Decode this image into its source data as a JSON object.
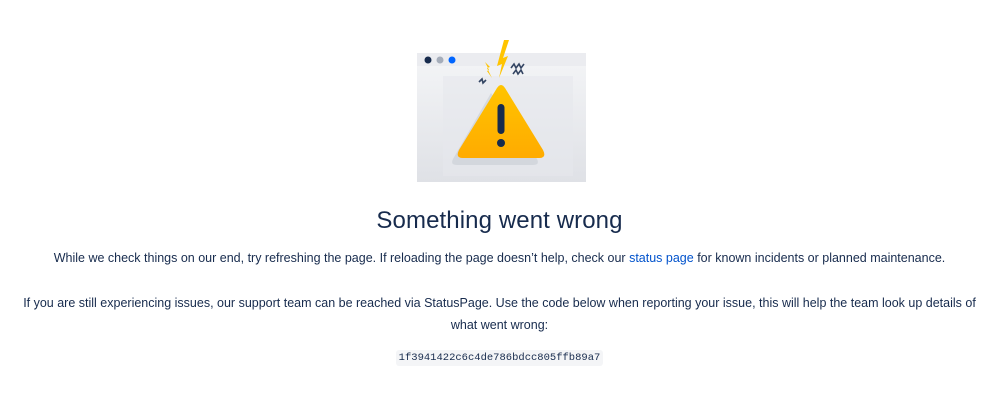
{
  "error": {
    "title": "Something went wrong",
    "description_before": "While we check things on our end, try refreshing the page. If reloading the page doesn’t help, check our ",
    "status_link": "status page",
    "description_after": " for known incidents or planned maintenance.",
    "support_text": "If you are still experiencing issues, our support team can be reached via StatusPage. Use the code below when reporting your issue, this will help the team look up details of what went wrong:",
    "error_code": "1f3941422c6c4de786bdcc805ffb89a7"
  },
  "colors": {
    "text": "#172b4d",
    "link": "#0052cc",
    "warning": "#ffc400"
  },
  "icons": {
    "illustration": "browser-warning-illustration"
  }
}
